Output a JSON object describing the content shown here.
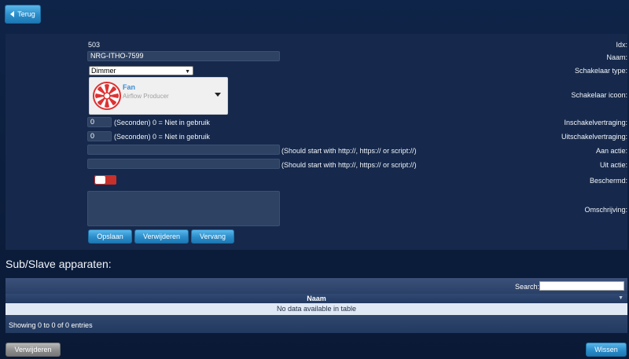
{
  "toolbar": {
    "back_label": "Terug"
  },
  "form": {
    "idx_label": "Idx:",
    "idx_value": "503",
    "name_label": "Naam:",
    "name_value": "NRG-ITHO-7599",
    "switch_type_label": "Schakelaar type:",
    "switch_type_value": "Dimmer",
    "switch_icon_label": "Schakelaar icoon:",
    "icon_title": "Fan",
    "icon_subtitle": "Airflow Producer",
    "on_delay_label": "Inschakelvertraging:",
    "on_delay_value": "0",
    "on_delay_hint": "(Seconden) 0 = Niet in gebruik",
    "off_delay_label": "Uitschakelvertraging:",
    "off_delay_value": "0",
    "off_delay_hint": "(Seconden) 0 = Niet in gebruik",
    "on_action_label": "Aan actie:",
    "on_action_value": "",
    "on_action_hint": "(Should start with http://, https:// or script://)",
    "off_action_label": "Uit actie:",
    "off_action_value": "",
    "off_action_hint": "(Should start with http://, https:// or script://)",
    "protected_label": "Beschermd:",
    "description_label": "Omschrijving:",
    "description_value": "",
    "save_label": "Opslaan",
    "delete_label": "Verwijderen",
    "replace_label": "Vervang"
  },
  "subdevices": {
    "title": "Sub/Slave apparaten:",
    "search_label": "Search:",
    "column_name": "Naam",
    "empty_text": "No data available in table",
    "info_text": "Showing 0 to 0 of 0 entries",
    "delete_label": "Verwijderen",
    "clear_label": "Wissen"
  }
}
